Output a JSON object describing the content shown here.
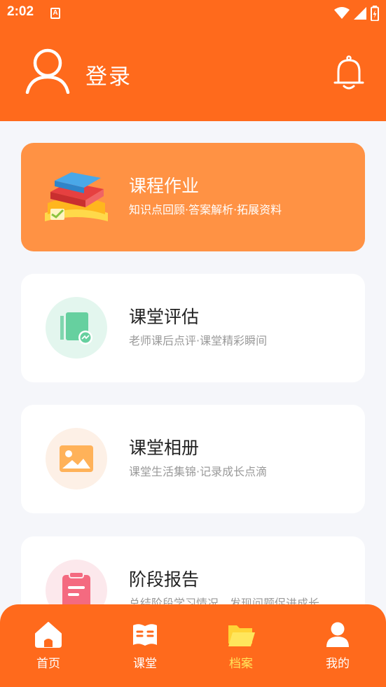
{
  "status_bar": {
    "time": "2:02",
    "notification_letter": "A"
  },
  "header": {
    "login_label": "登录"
  },
  "cards": [
    {
      "title": "课程作业",
      "subtitle": "知识点回顾·答案解析·拓展资料",
      "icon": "books-icon",
      "accent": "#ff9244"
    },
    {
      "title": "课堂评估",
      "subtitle": "老师课后点评·课堂精彩瞬间",
      "icon": "assessment-icon",
      "accent": "#e3f6ee"
    },
    {
      "title": "课堂相册",
      "subtitle": "课堂生活集锦·记录成长点滴",
      "icon": "photo-icon",
      "accent": "#fdf0e6"
    },
    {
      "title": "阶段报告",
      "subtitle": "总结阶段学习情况，发现问题促进成长",
      "icon": "clipboard-icon",
      "accent": "#fce8ec"
    }
  ],
  "tabbar": {
    "items": [
      {
        "label": "首页",
        "icon": "home-icon"
      },
      {
        "label": "课堂",
        "icon": "book-open-icon"
      },
      {
        "label": "档案",
        "icon": "folder-icon",
        "active": true
      },
      {
        "label": "我的",
        "icon": "user-icon"
      }
    ]
  },
  "colors": {
    "brand": "#ff6a1c",
    "highlight_card": "#ff9244",
    "active_tab": "#ffe65c"
  }
}
